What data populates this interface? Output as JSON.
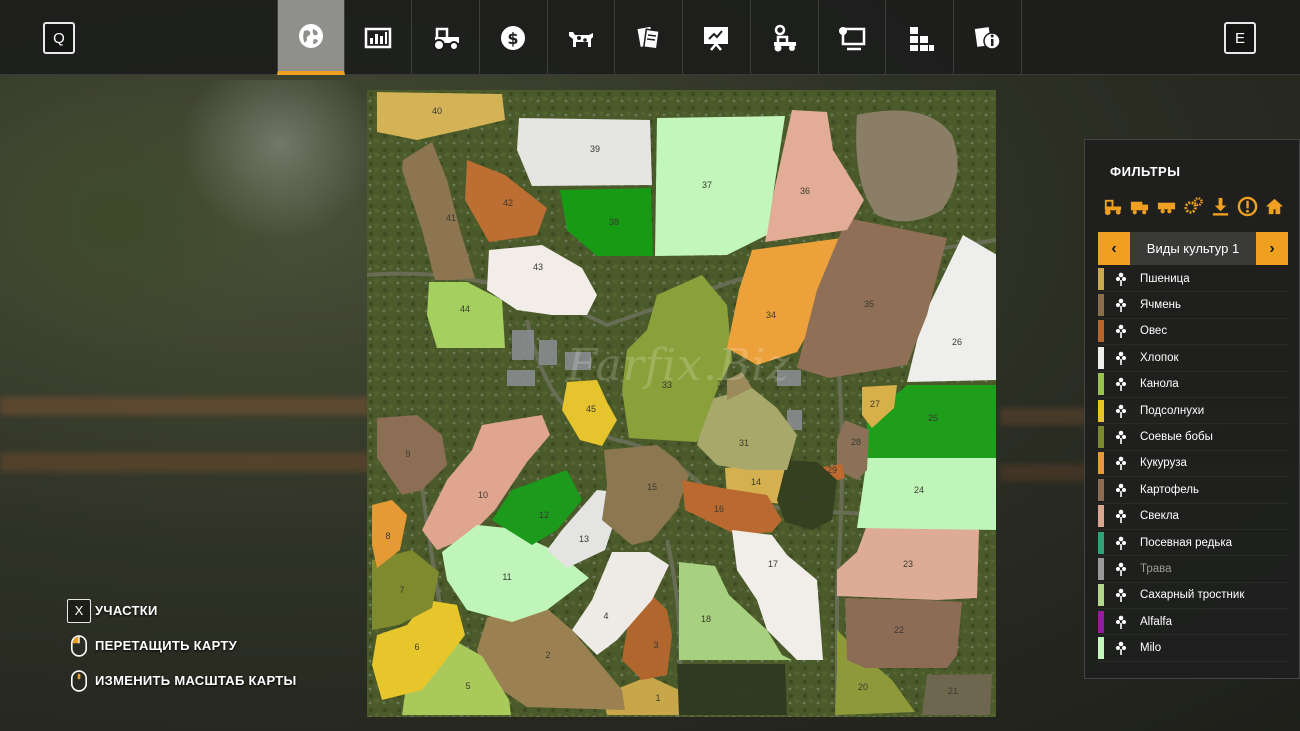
{
  "top_bar": {
    "left_key": "Q",
    "right_key": "E",
    "tabs": [
      {
        "icon": "globe-map-icon",
        "active": true
      },
      {
        "icon": "statistics-icon",
        "active": false
      },
      {
        "icon": "tractor-icon",
        "active": false
      },
      {
        "icon": "finances-icon",
        "active": false
      },
      {
        "icon": "animals-icon",
        "active": false
      },
      {
        "icon": "contracts-icon",
        "active": false
      },
      {
        "icon": "price-board-icon",
        "active": false
      },
      {
        "icon": "vehicle-settings-icon",
        "active": false
      },
      {
        "icon": "computer-settings-icon",
        "active": false
      },
      {
        "icon": "production-icon",
        "active": false
      },
      {
        "icon": "help-info-icon",
        "active": false
      }
    ]
  },
  "map": {
    "watermark": "Farfix.Biz",
    "fields": [
      {
        "id": "1",
        "color": "#c8a64a"
      },
      {
        "id": "2",
        "color": "#9b8152"
      },
      {
        "id": "3",
        "color": "#b0662c"
      },
      {
        "id": "4",
        "color": "#eeeae6"
      },
      {
        "id": "5",
        "color": "#a9c95a"
      },
      {
        "id": "6",
        "color": "#e6c62a"
      },
      {
        "id": "7",
        "color": "#7f8a2e"
      },
      {
        "id": "8",
        "color": "#e69a35"
      },
      {
        "id": "9",
        "color": "#8c6e54"
      },
      {
        "id": "10",
        "color": "#dfa58e"
      },
      {
        "id": "11",
        "color": "#bff5b9"
      },
      {
        "id": "12",
        "color": "#1b9a1b"
      },
      {
        "id": "13",
        "color": "#e4e4e2"
      },
      {
        "id": "14",
        "color": "#d5b050"
      },
      {
        "id": "15",
        "color": "#8c7750"
      },
      {
        "id": "16",
        "color": "#ba6a30"
      },
      {
        "id": "17",
        "color": "#f1eeea"
      },
      {
        "id": "18",
        "color": "#a7d17f"
      },
      {
        "id": "19",
        "color": "#2f3a20"
      },
      {
        "id": "20",
        "color": "#8e9a3a"
      },
      {
        "id": "21",
        "color": "#6f6650"
      },
      {
        "id": "22",
        "color": "#8d6c56"
      },
      {
        "id": "23",
        "color": "#deab97"
      },
      {
        "id": "24",
        "color": "#bff5b9"
      },
      {
        "id": "25",
        "color": "#1e9e1a"
      },
      {
        "id": "26",
        "color": "#eeeeec"
      },
      {
        "id": "27",
        "color": "#d8b04a"
      },
      {
        "id": "28",
        "color": "#8a7158"
      },
      {
        "id": "29",
        "color": "#c06a32"
      },
      {
        "id": "30",
        "color": "#34401f"
      },
      {
        "id": "31",
        "color": "#a8a86a"
      },
      {
        "id": "32",
        "color": "#9c8a5a"
      },
      {
        "id": "33",
        "color": "#8aa03a"
      },
      {
        "id": "34",
        "color": "#eca13a"
      },
      {
        "id": "35",
        "color": "#8f6f56"
      },
      {
        "id": "36",
        "color": "#e3ac96"
      },
      {
        "id": "37",
        "color": "#c2f6bb"
      },
      {
        "id": "38",
        "color": "#179a14"
      },
      {
        "id": "39",
        "color": "#e5e5e3"
      },
      {
        "id": "40",
        "color": "#d4b256"
      },
      {
        "id": "41",
        "color": "#8e7552"
      },
      {
        "id": "42",
        "color": "#bd6e32"
      },
      {
        "id": "43",
        "color": "#f2ede8"
      },
      {
        "id": "44",
        "color": "#a5cf5e"
      },
      {
        "id": "45",
        "color": "#e5c42e"
      }
    ]
  },
  "filters": {
    "title": "ФИЛЬТРЫ",
    "filter_icons": [
      "tractor-icon",
      "truck-icon",
      "trailer-icon",
      "gears-icon",
      "download-icon",
      "warning-icon",
      "farmhouse-icon"
    ],
    "accent_color": "#f0a020",
    "selector_label": "Виды культур 1",
    "prev": "‹",
    "next": "›",
    "crops": [
      {
        "label": "Пшеница",
        "color": "#c9a84f",
        "icon": "wheat-icon",
        "dim": false
      },
      {
        "label": "Ячмень",
        "color": "#8a7048",
        "icon": "barley-icon",
        "dim": false
      },
      {
        "label": "Овес",
        "color": "#b9652b",
        "icon": "oat-icon",
        "dim": false
      },
      {
        "label": "Хлопок",
        "color": "#eeeeec",
        "icon": "cotton-icon",
        "dim": false
      },
      {
        "label": "Канола",
        "color": "#98c24f",
        "icon": "canola-icon",
        "dim": false
      },
      {
        "label": "Подсолнухи",
        "color": "#e8c42a",
        "icon": "sunflower-icon",
        "dim": false
      },
      {
        "label": "Соевые бобы",
        "color": "#7c8a2d",
        "icon": "soybean-icon",
        "dim": false
      },
      {
        "label": "Кукуруза",
        "color": "#e89a33",
        "icon": "corn-icon",
        "dim": false
      },
      {
        "label": "Картофель",
        "color": "#8b6b52",
        "icon": "potato-icon",
        "dim": false
      },
      {
        "label": "Свекла",
        "color": "#dba690",
        "icon": "beet-icon",
        "dim": false
      },
      {
        "label": "Посевная редька",
        "color": "#2aa67a",
        "icon": "radish-icon",
        "dim": false
      },
      {
        "label": "Трава",
        "color": "#9a9a9a",
        "icon": "grass-icon",
        "dim": true
      },
      {
        "label": "Сахарный тростник",
        "color": "#b3d88a",
        "icon": "sugarcane-icon",
        "dim": false
      },
      {
        "label": "Alfalfa",
        "color": "#9b18a0",
        "icon": "alfalfa-icon",
        "dim": false
      },
      {
        "label": "Milo",
        "color": "#c4f7bc",
        "icon": "milo-icon",
        "dim": false
      }
    ]
  },
  "legend": {
    "items": [
      {
        "key": "X",
        "label": "УЧАСТКИ",
        "icon": "x-key-icon"
      },
      {
        "key": "",
        "label": "ПЕРЕТАЩИТЬ КАРТУ",
        "icon": "mouse-drag-icon"
      },
      {
        "key": "",
        "label": "ИЗМЕНИТЬ МАСШТАБ КАРТЫ",
        "icon": "mouse-wheel-icon"
      }
    ]
  }
}
